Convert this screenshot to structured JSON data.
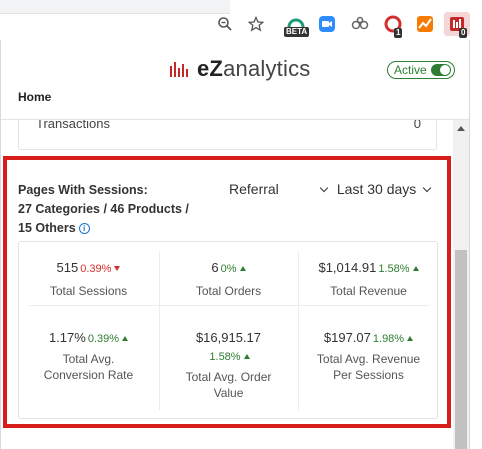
{
  "toolbar": {
    "badge_beta": "BETA",
    "badge_count1": "1",
    "badge_count2": "0"
  },
  "header": {
    "logo_prefix": "eZ",
    "logo_suffix": "analytics",
    "active_label": "Active",
    "home": "Home"
  },
  "transactions": {
    "label": "Transactions",
    "value": "0"
  },
  "pages": {
    "title_line1": "Pages With Sessions:",
    "title_line2": "27 Categories / 46 Products /",
    "title_line3": "15 Others",
    "info": "i",
    "source": "Referral",
    "range": "Last 30 days"
  },
  "metrics": [
    {
      "value": "515",
      "change": "0.39%",
      "trend": "down",
      "label": "Total Sessions"
    },
    {
      "value": "6",
      "change": "0%",
      "trend": "up",
      "label": "Total Orders"
    },
    {
      "value": "$1,014.91",
      "change": "1.58%",
      "trend": "up",
      "label": "Total Revenue"
    },
    {
      "value": "1.17%",
      "change": "0.39%",
      "trend": "up",
      "label_line1": "Total Avg.",
      "label_line2": "Conversion Rate"
    },
    {
      "value": "$16,915.17",
      "change": "1.58%",
      "trend": "up",
      "label_line1": "Total Avg. Order",
      "label_line2": "Value"
    },
    {
      "value": "$197.07",
      "change": "1.98%",
      "trend": "up",
      "label_line1": "Total Avg. Revenue",
      "label_line2": "Per Sessions"
    }
  ],
  "colors": {
    "accent": "#2e7d32",
    "down": "#d32f2f",
    "highlight": "#d81b1b"
  }
}
